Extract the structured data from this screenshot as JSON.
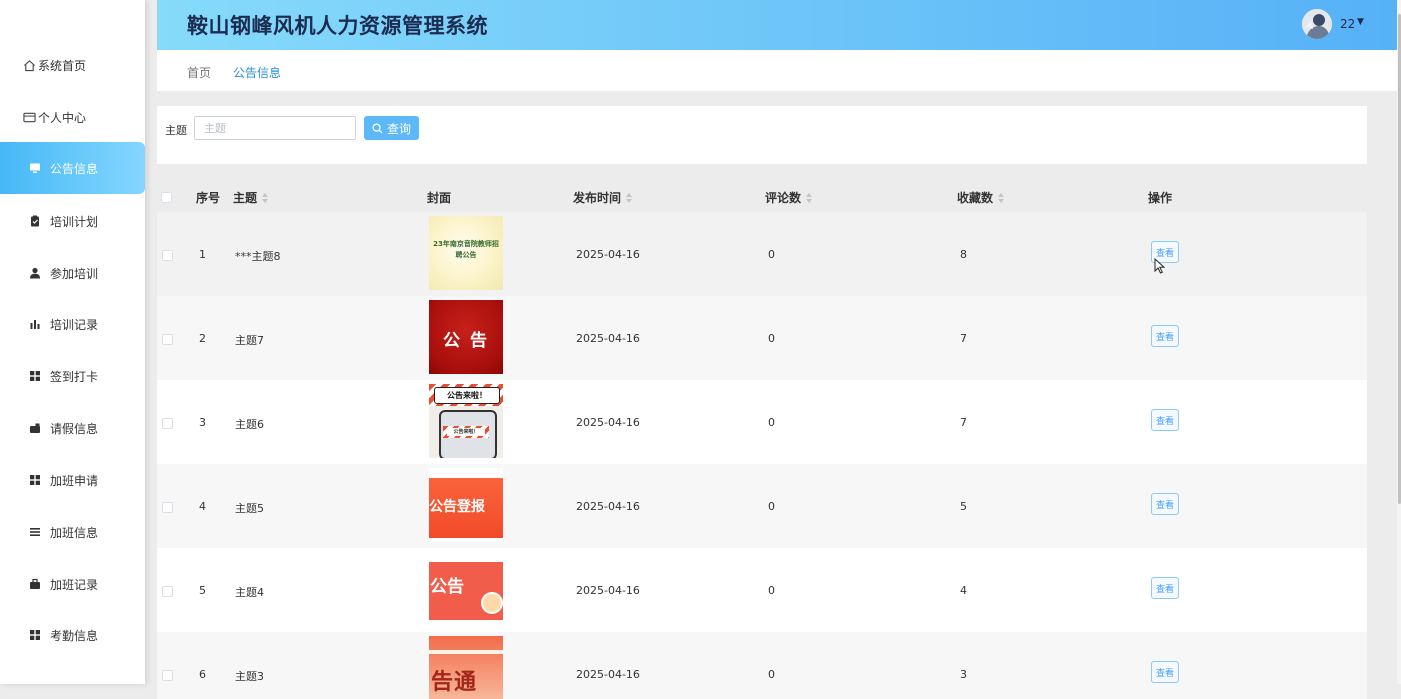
{
  "app": {
    "title": "鞍山钢峰风机人力资源管理系统"
  },
  "user": {
    "name": "22"
  },
  "sidebar": {
    "items": [
      {
        "label": "系统首页",
        "icon": "home-icon"
      },
      {
        "label": "个人中心",
        "icon": "id-card-icon"
      },
      {
        "label": "公告信息",
        "icon": "monitor-icon",
        "active": true
      },
      {
        "label": "培训计划",
        "icon": "clipboard-icon"
      },
      {
        "label": "参加培训",
        "icon": "user-icon"
      },
      {
        "label": "培训记录",
        "icon": "bar-chart-icon"
      },
      {
        "label": "签到打卡",
        "icon": "grid-icon"
      },
      {
        "label": "请假信息",
        "icon": "briefcase-icon"
      },
      {
        "label": "加班申请",
        "icon": "grid-icon"
      },
      {
        "label": "加班信息",
        "icon": "list-icon"
      },
      {
        "label": "加班记录",
        "icon": "briefcase-icon"
      },
      {
        "label": "考勤信息",
        "icon": "grid-icon"
      }
    ]
  },
  "breadcrumb": {
    "home": "首页",
    "current": "公告信息"
  },
  "search": {
    "label": "主题",
    "placeholder": "主题",
    "value": "",
    "button": "查询"
  },
  "table": {
    "columns": {
      "index": "序号",
      "subject": "主题",
      "cover": "封面",
      "publish_time": "发布时间",
      "comments": "评论数",
      "favorites": "收藏数",
      "actions": "操作"
    },
    "view_label": "查看",
    "rows": [
      {
        "index": "1",
        "subject": "***主题8",
        "cover_text": "23年南京音院教师招聘公告",
        "publish_time": "2025-04-16",
        "comments": "0",
        "favorites": "8"
      },
      {
        "index": "2",
        "subject": "主题7",
        "cover_text": "公 告",
        "publish_time": "2025-04-16",
        "comments": "0",
        "favorites": "7"
      },
      {
        "index": "3",
        "subject": "主题6",
        "cover_text": "公告来啦！",
        "publish_time": "2025-04-16",
        "comments": "0",
        "favorites": "7"
      },
      {
        "index": "4",
        "subject": "主题5",
        "cover_text": "公告登报",
        "publish_time": "2025-04-16",
        "comments": "0",
        "favorites": "5"
      },
      {
        "index": "5",
        "subject": "主题4",
        "cover_text": "公告",
        "publish_time": "2025-04-16",
        "comments": "0",
        "favorites": "4"
      },
      {
        "index": "6",
        "subject": "主题3",
        "cover_text": "告通",
        "publish_time": "2025-04-16",
        "comments": "0",
        "favorites": "3"
      }
    ]
  },
  "colors": {
    "accent": "#5cb8f6",
    "header_start": "#86dbfa",
    "header_end": "#56b1f7",
    "title": "#1c2b50"
  }
}
